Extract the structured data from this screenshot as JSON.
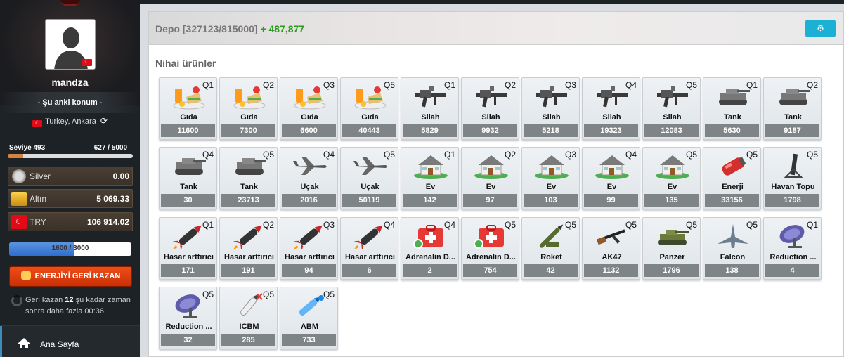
{
  "user": {
    "name": "mandza",
    "current_location_label": "- Şu anki konum -",
    "location": "Turkey, Ankara"
  },
  "level": {
    "label": "Seviye 493",
    "xp": "627 / 5000",
    "progress": 0.125
  },
  "currencies": [
    {
      "name": "Silver",
      "value": "0.00",
      "icon": "silver-coin-icon",
      "color": "#b0b0b0"
    },
    {
      "name": "Altın",
      "value": "5 069.33",
      "icon": "gold-bars-icon",
      "color": "#e0a020"
    },
    {
      "name": "TRY",
      "value": "106 914.02",
      "icon": "turkey-flag-icon",
      "color": "#e30a17"
    }
  ],
  "energy": {
    "text": "1600 / 3000",
    "progress": 0.5333
  },
  "energy_button": "ENERJİYİ GERİ KAZAN",
  "regain": {
    "prefix": "Geri kazan",
    "amount": "12",
    "mid": "şu kadar zaman sonra daha fazla",
    "time": "00:36"
  },
  "nav": {
    "home": "Ana Sayfa"
  },
  "panel": {
    "title": "Depo [327123/815000]",
    "gain": "+ 487,877",
    "settings_icon": "gear-icon"
  },
  "section_title": "Nihai ürünler",
  "products": [
    {
      "name": "Gıda",
      "q": "Q1",
      "amount": "11600",
      "icon": "food"
    },
    {
      "name": "Gıda",
      "q": "Q2",
      "amount": "7300",
      "icon": "food"
    },
    {
      "name": "Gıda",
      "q": "Q3",
      "amount": "6600",
      "icon": "food"
    },
    {
      "name": "Gıda",
      "q": "Q5",
      "amount": "40443",
      "icon": "food"
    },
    {
      "name": "Silah",
      "q": "Q1",
      "amount": "5829",
      "icon": "gun"
    },
    {
      "name": "Silah",
      "q": "Q2",
      "amount": "9932",
      "icon": "gun"
    },
    {
      "name": "Silah",
      "q": "Q3",
      "amount": "5218",
      "icon": "gun"
    },
    {
      "name": "Silah",
      "q": "Q4",
      "amount": "19323",
      "icon": "gun"
    },
    {
      "name": "Silah",
      "q": "Q5",
      "amount": "12083",
      "icon": "gun"
    },
    {
      "name": "Tank",
      "q": "Q1",
      "amount": "5630",
      "icon": "tank"
    },
    {
      "name": "Tank",
      "q": "Q2",
      "amount": "9187",
      "icon": "tank"
    },
    {
      "name": "Tank",
      "q": "Q4",
      "amount": "30",
      "icon": "tank"
    },
    {
      "name": "Tank",
      "q": "Q5",
      "amount": "23713",
      "icon": "tank"
    },
    {
      "name": "Uçak",
      "q": "Q4",
      "amount": "2016",
      "icon": "plane"
    },
    {
      "name": "Uçak",
      "q": "Q5",
      "amount": "50119",
      "icon": "plane"
    },
    {
      "name": "Ev",
      "q": "Q1",
      "amount": "142",
      "icon": "house"
    },
    {
      "name": "Ev",
      "q": "Q2",
      "amount": "97",
      "icon": "house"
    },
    {
      "name": "Ev",
      "q": "Q3",
      "amount": "103",
      "icon": "house"
    },
    {
      "name": "Ev",
      "q": "Q4",
      "amount": "99",
      "icon": "house"
    },
    {
      "name": "Ev",
      "q": "Q5",
      "amount": "135",
      "icon": "house"
    },
    {
      "name": "Enerji",
      "q": "Q5",
      "amount": "33156",
      "icon": "energy"
    },
    {
      "name": "Havan Topu",
      "q": "Q5",
      "amount": "1798",
      "icon": "mortar"
    },
    {
      "name": "Hasar arttırıcı",
      "q": "Q1",
      "amount": "171",
      "icon": "rocket"
    },
    {
      "name": "Hasar arttırıcı",
      "q": "Q2",
      "amount": "191",
      "icon": "rocket"
    },
    {
      "name": "Hasar arttırıcı",
      "q": "Q3",
      "amount": "94",
      "icon": "rocket"
    },
    {
      "name": "Hasar arttırıcı",
      "q": "Q4",
      "amount": "6",
      "icon": "rocket"
    },
    {
      "name": "Adrenalin D...",
      "q": "Q4",
      "amount": "2",
      "icon": "medkit"
    },
    {
      "name": "Adrenalin D...",
      "q": "Q5",
      "amount": "754",
      "icon": "medkit"
    },
    {
      "name": "Roket",
      "q": "Q5",
      "amount": "42",
      "icon": "launcher"
    },
    {
      "name": "AK47",
      "q": "Q5",
      "amount": "1132",
      "icon": "rifle"
    },
    {
      "name": "Panzer",
      "q": "Q5",
      "amount": "1796",
      "icon": "panzer"
    },
    {
      "name": "Falcon",
      "q": "Q5",
      "amount": "138",
      "icon": "jet"
    },
    {
      "name": "Reduction ...",
      "q": "Q1",
      "amount": "4",
      "icon": "radar"
    },
    {
      "name": "Reduction ...",
      "q": "Q5",
      "amount": "32",
      "icon": "radar"
    },
    {
      "name": "ICBM",
      "q": "Q5",
      "amount": "285",
      "icon": "icbm"
    },
    {
      "name": "ABM",
      "q": "Q5",
      "amount": "733",
      "icon": "abm"
    }
  ]
}
